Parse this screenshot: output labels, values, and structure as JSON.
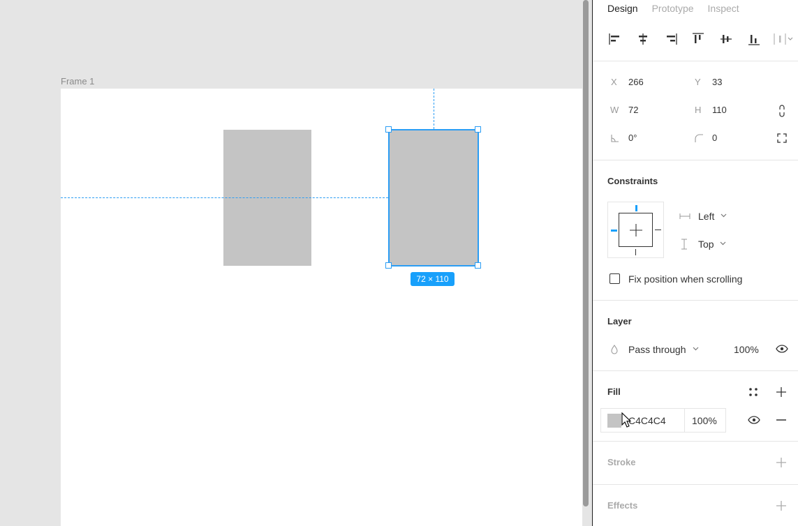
{
  "canvas": {
    "frame_label": "Frame 1",
    "size_badge": "72 × 110",
    "shape_fill": "#C4C4C4",
    "selection_color": "#18A0FB"
  },
  "panel": {
    "tabs": [
      {
        "label": "Design",
        "active": true
      },
      {
        "label": "Prototype",
        "active": false
      },
      {
        "label": "Inspect",
        "active": false
      }
    ],
    "align_icons": [
      "align-left-icon",
      "align-horizontal-center-icon",
      "align-right-icon",
      "align-top-icon",
      "align-vertical-center-icon",
      "align-bottom-icon",
      "distribute-icon"
    ],
    "position": {
      "x_label": "X",
      "x": "266",
      "y_label": "Y",
      "y": "33",
      "w_label": "W",
      "w": "72",
      "h_label": "H",
      "h": "110",
      "rotation": "0°",
      "radius": "0"
    },
    "constraints": {
      "title": "Constraints",
      "horizontal": "Left",
      "vertical": "Top",
      "fix_position_label": "Fix position when scrolling"
    },
    "layer": {
      "title": "Layer",
      "blend_mode": "Pass through",
      "opacity": "100%"
    },
    "fill": {
      "title": "Fill",
      "hex": "C4C4C4",
      "opacity": "100%"
    },
    "stroke": {
      "title": "Stroke"
    },
    "effects": {
      "title": "Effects"
    }
  }
}
